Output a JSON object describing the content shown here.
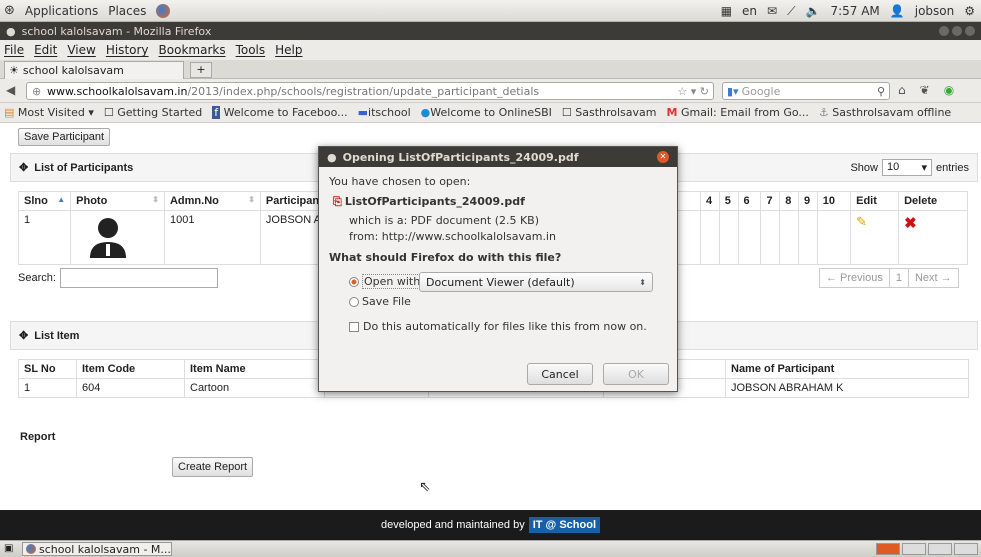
{
  "panel": {
    "menus": [
      "Applications",
      "Places"
    ],
    "keyboard": "en",
    "clock": "7:57 AM",
    "user": "jobson"
  },
  "window": {
    "title": "school kalolsavam - Mozilla Firefox"
  },
  "menubar": [
    "File",
    "Edit",
    "View",
    "History",
    "Bookmarks",
    "Tools",
    "Help"
  ],
  "tab": {
    "label": "school kalolsavam",
    "new_tab": "+"
  },
  "navbar": {
    "url_host": "www.schoolkalolsavam.in",
    "url_path": "/2013/index.php/schools/registration/update_participant_detials",
    "search_placeholder": "Google"
  },
  "bookmarks": [
    "Most Visited ▾",
    "Getting Started",
    "Welcome to Faceboo...",
    "itschool",
    "Welcome to OnlineSBI",
    "Sasthrolsavam",
    "Gmail: Email from Go...",
    "Sasthrolsavam offline"
  ],
  "page": {
    "save_button": "Save Participant",
    "participants": {
      "title": "List of Participants",
      "show_label": "Show",
      "show_value": "10",
      "entries_label": "entries",
      "columns": [
        "Slno",
        "Photo",
        "Admn.No",
        "Participant N",
        "4",
        "5",
        "6",
        "7",
        "8",
        "9",
        "10",
        "Edit",
        "Delete"
      ],
      "rows": [
        {
          "slno": "1",
          "admn": "1001",
          "name": "JOBSON ABF"
        }
      ],
      "search_label": "Search:",
      "pager": {
        "previous": "← Previous",
        "page": "1",
        "next": "Next →"
      }
    },
    "items": {
      "title": "List Item",
      "columns": [
        "SL No",
        "Item Code",
        "Item Name",
        "y",
        "Name of Participant"
      ],
      "rows": [
        {
          "sl": "1",
          "code": "604",
          "name": "Cartoon",
          "participant": "JOBSON ABRAHAM K"
        }
      ]
    },
    "report": {
      "label": "Report",
      "button": "Create Report"
    }
  },
  "footer": {
    "text": "developed and maintained by",
    "brand": "IT @ School"
  },
  "taskbar": {
    "window": "school kalolsavam - M..."
  },
  "dialog": {
    "title": "Opening ListOfParticipants_24009.pdf",
    "intro": "You have chosen to open:",
    "filename": "ListOfParticipants_24009.pdf",
    "which_is": "which is a:  PDF document (2.5 KB)",
    "from": "from:  http://www.schoolkalolsavam.in",
    "question": "What should Firefox do with this file?",
    "open_with": "Open with",
    "viewer": "Document Viewer (default)",
    "save_file": "Save File",
    "auto": "Do this automatically for files like this from now on.",
    "cancel": "Cancel",
    "ok": "OK"
  },
  "colors": {
    "accent": "#e05a24",
    "titlebar": "#3c3b37",
    "footer": "#1b1b1b",
    "delete": "#cc1111"
  }
}
